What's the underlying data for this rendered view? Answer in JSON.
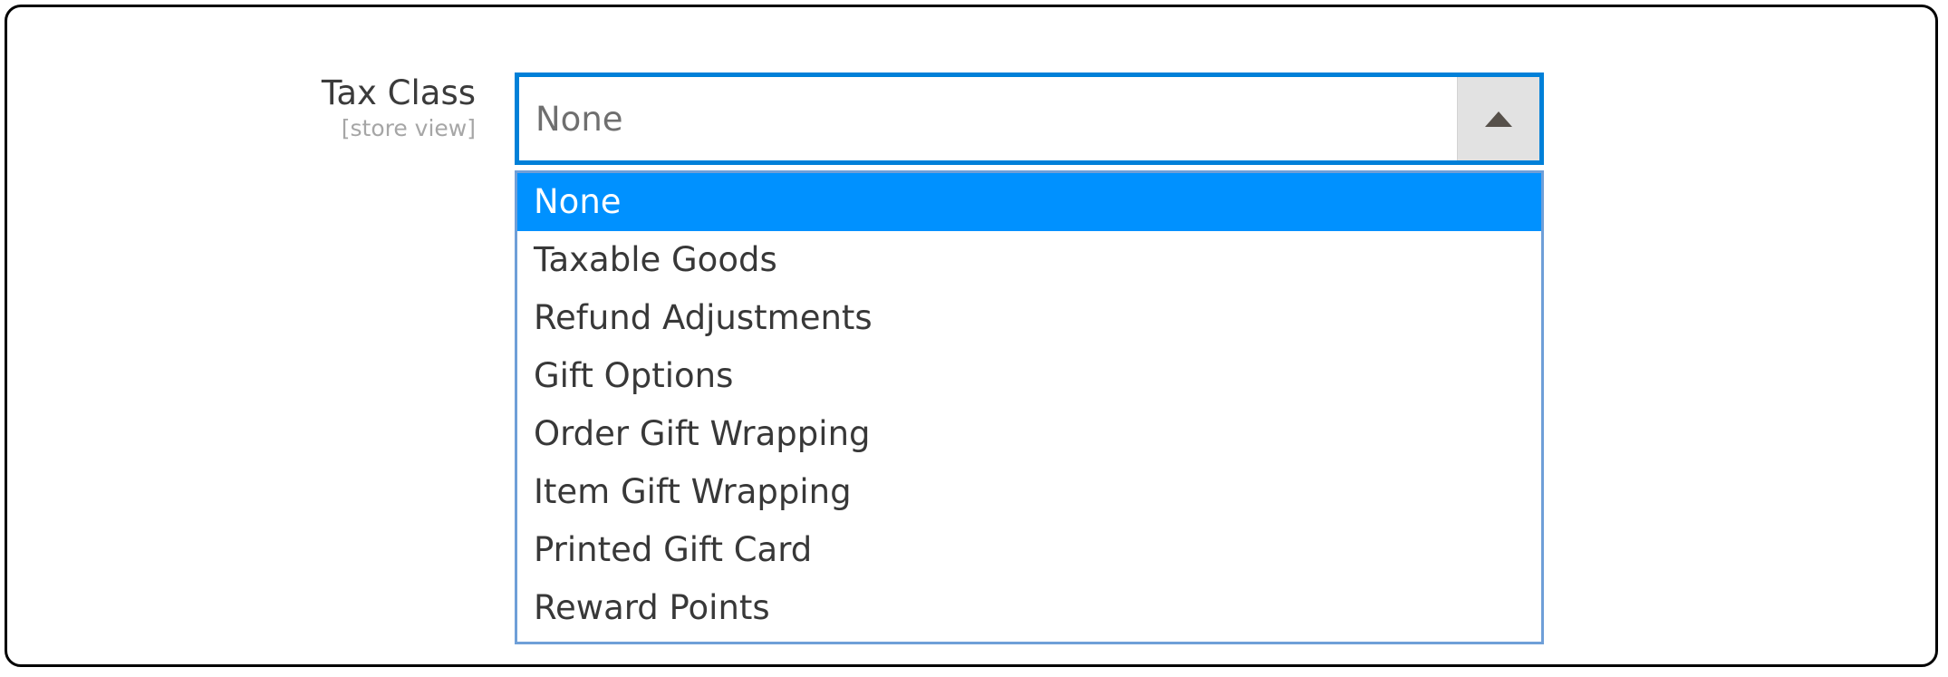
{
  "form_field": {
    "label": "Tax Class",
    "scope_note": "[store view]"
  },
  "select": {
    "value": "None",
    "placeholder": "None",
    "toggle_icon": "caret-up-icon",
    "expanded": true,
    "border_color": "#0080d8",
    "toggle_background": "#e2e2e2",
    "toggle_arrow_color": "#56504a"
  },
  "dropdown": {
    "border_color": "#6f9fd8",
    "highlight_color": "#0091ff",
    "highlight_text_color": "#ffffff",
    "option_text_color": "#383838",
    "selected_index": 0,
    "options": [
      {
        "label": "None",
        "selected": true
      },
      {
        "label": "Taxable Goods",
        "selected": false
      },
      {
        "label": "Refund Adjustments",
        "selected": false
      },
      {
        "label": "Gift Options",
        "selected": false
      },
      {
        "label": "Order Gift Wrapping",
        "selected": false
      },
      {
        "label": "Item Gift Wrapping",
        "selected": false
      },
      {
        "label": "Printed Gift Card",
        "selected": false
      },
      {
        "label": "Reward Points",
        "selected": false
      }
    ]
  },
  "frame": {
    "border_color": "#000000",
    "background": "#ffffff"
  }
}
